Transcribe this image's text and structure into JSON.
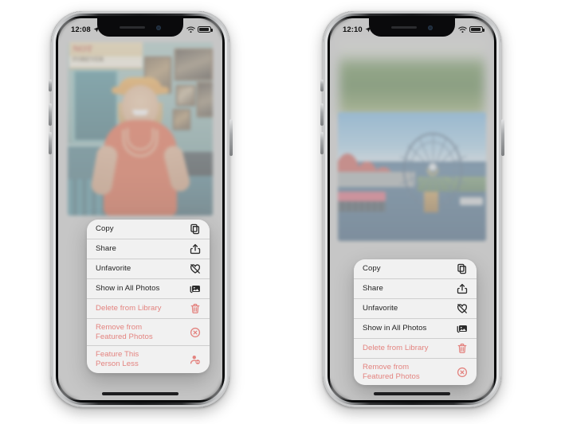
{
  "page": {
    "background": "#ffffff",
    "description": "Two iPhone screenshots side by side showing the Photos app context menu"
  },
  "phones": [
    {
      "id": "left",
      "status_bar": {
        "time": "12:08",
        "location_icon": "location-arrow-icon",
        "wifi_icon": "wifi-icon",
        "battery_icon": "battery-icon"
      },
      "photo": {
        "name": "woman-in-vintage-shop-photo",
        "sign_line1": "NOT",
        "sign_line2": "FOREVER"
      },
      "context_menu": {
        "items": [
          {
            "label": "Copy",
            "icon": "copy-icon",
            "destructive": false
          },
          {
            "label": "Share",
            "icon": "share-icon",
            "destructive": false
          },
          {
            "label": "Unfavorite",
            "icon": "heart-slash-icon",
            "destructive": false
          },
          {
            "label": "Show in All Photos",
            "icon": "photo-stack-icon",
            "destructive": false
          },
          {
            "label": "Delete from Library",
            "icon": "trash-icon",
            "destructive": true
          },
          {
            "label": "Remove from\nFeatured Photos",
            "icon": "x-circle-icon",
            "destructive": true
          },
          {
            "label": "Feature This\nPerson Less",
            "icon": "person-minus-icon",
            "destructive": true
          }
        ]
      }
    },
    {
      "id": "right",
      "status_bar": {
        "time": "12:10",
        "location_icon": "location-arrow-icon",
        "wifi_icon": "wifi-icon",
        "battery_icon": "battery-icon"
      },
      "photo": {
        "name": "pixar-pier-ferris-wheel-photo",
        "background_photo": "blurred-green-landscape-photo"
      },
      "context_menu": {
        "items": [
          {
            "label": "Copy",
            "icon": "copy-icon",
            "destructive": false
          },
          {
            "label": "Share",
            "icon": "share-icon",
            "destructive": false
          },
          {
            "label": "Unfavorite",
            "icon": "heart-slash-icon",
            "destructive": false
          },
          {
            "label": "Show in All Photos",
            "icon": "photo-stack-icon",
            "destructive": false
          },
          {
            "label": "Delete from Library",
            "icon": "trash-icon",
            "destructive": true
          },
          {
            "label": "Remove from\nFeatured Photos",
            "icon": "x-circle-icon",
            "destructive": true
          }
        ]
      }
    }
  ],
  "colors": {
    "destructive_text": "#e3837f",
    "normal_text": "#232323",
    "menu_background": "rgba(248,248,248,0.86)",
    "page_background": "#ffffff"
  }
}
